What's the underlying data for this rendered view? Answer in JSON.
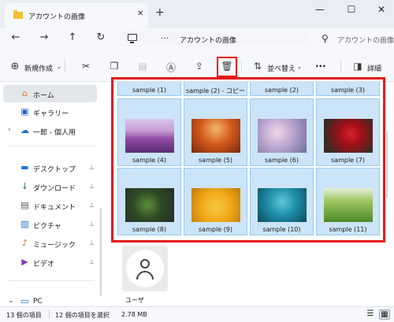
{
  "window": {
    "tab_title": "アカウントの画像",
    "tab_close": "✕",
    "tab_add": "+",
    "minimize": "—",
    "maximize": "☐",
    "close": "✕"
  },
  "address": {
    "back": "←",
    "forward": "→",
    "up": "↑",
    "refresh": "↻",
    "dots": "···",
    "path": "アカウントの画像",
    "search_placeholder": "アカウントの画像"
  },
  "toolbar": {
    "new_label": "新規作成",
    "sort_label": "並べ替え",
    "more": "···",
    "details_label": "詳細"
  },
  "sidebar": {
    "items": [
      {
        "label": "ホーム",
        "icon": "home-icon"
      },
      {
        "label": "ギャラリー",
        "icon": "gallery-icon"
      },
      {
        "label": "一郎 - 個人用",
        "icon": "cloud-icon"
      },
      {
        "label": "デスクトップ",
        "icon": "desktop-icon"
      },
      {
        "label": "ダウンロード",
        "icon": "download-icon"
      },
      {
        "label": "ドキュメント",
        "icon": "document-icon"
      },
      {
        "label": "ピクチャ",
        "icon": "pictures-icon"
      },
      {
        "label": "ミュージック",
        "icon": "music-icon"
      },
      {
        "label": "ビデオ",
        "icon": "video-icon"
      },
      {
        "label": "PC",
        "icon": "pc-icon"
      }
    ],
    "pin": "📌"
  },
  "files": {
    "top_row": [
      "sample (1)",
      "sample (2) - コピー",
      "sample (2)",
      "sample (3)"
    ],
    "row2": [
      "sample (4)",
      "sample (5)",
      "sample (6)",
      "sample (7)"
    ],
    "row3": [
      "sample (8)",
      "sample (9)",
      "sample (10)",
      "sample (11)"
    ],
    "user_folder": "ユーザ"
  },
  "status": {
    "item_count": "13 個の項目",
    "selection": "12 個の項目を選択",
    "size": "2.78 MB"
  },
  "colors": {
    "selection_fill": "#cce4f7",
    "selection_border": "#99c9ef",
    "highlight_red": "#e31818"
  }
}
